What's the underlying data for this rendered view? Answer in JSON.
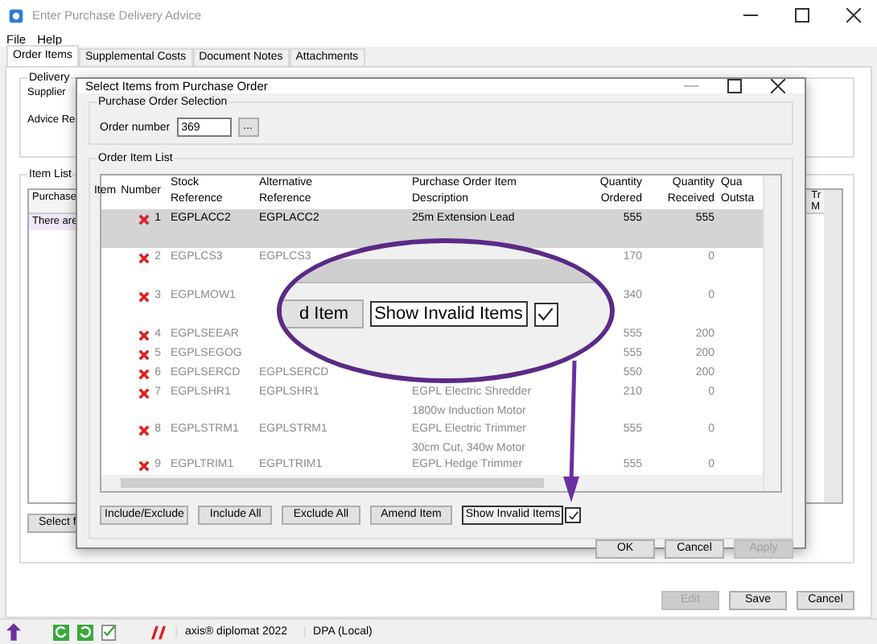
{
  "window": {
    "title": "Enter Purchase Delivery Advice"
  },
  "menu": [
    "File",
    "Help"
  ],
  "tabs": [
    {
      "label": "Order Items",
      "selected": true
    },
    {
      "label": "Supplemental Costs",
      "selected": false
    },
    {
      "label": "Document Notes",
      "selected": false
    },
    {
      "label": "Attachments",
      "selected": false
    }
  ],
  "delivery": {
    "title": "Delivery",
    "labels": [
      "Supplier",
      "Advice Re"
    ]
  },
  "item_list": {
    "title": "Item List",
    "column_1": "Purchase",
    "row_text": "There are",
    "column_last": [
      "Tr",
      "M"
    ],
    "select_button": "Select f"
  },
  "bottom_buttons": [
    {
      "label": "Edit",
      "disabled": true
    },
    {
      "label": "Save",
      "disabled": false
    },
    {
      "label": "Cancel",
      "disabled": false
    }
  ],
  "status_bar": {
    "product": "axis® diplomat 2022",
    "database": "DPA (Local)"
  },
  "dialog": {
    "title": "Select Items from Purchase Order",
    "selection": {
      "title": "Purchase Order Selection",
      "label": "Order number",
      "value": "369",
      "browse": "..."
    },
    "list_title": "Order Item List",
    "columns": [
      [
        "Item",
        "Number"
      ],
      [
        "Stock",
        "Reference"
      ],
      [
        "Alternative",
        "Reference"
      ],
      [
        "Purchase Order Item",
        "Description"
      ],
      [
        "Quantity",
        "Ordered"
      ],
      [
        "Quantity",
        "Received"
      ],
      [
        "Qua",
        "Outsta"
      ]
    ],
    "rows": [
      {
        "number": "1",
        "stock": "EGPLACC2",
        "alt": "EGPLACC2",
        "description": [
          "25m Extension Lead"
        ],
        "ordered": "555",
        "received": "555",
        "excluded": true,
        "selected": true,
        "disabled": false
      },
      {
        "number": "2",
        "stock": "EGPLCS3",
        "alt": "EGPLCS3",
        "description": [],
        "ordered": "170",
        "received": "0",
        "excluded": true,
        "selected": false,
        "disabled": true
      },
      {
        "number": "3",
        "stock": "EGPLMOW1",
        "alt": "",
        "description": [],
        "ordered": "340",
        "received": "0",
        "excluded": true,
        "selected": false,
        "disabled": true
      },
      {
        "number": "4",
        "stock": "EGPLSEEAR",
        "alt": "",
        "description": [],
        "ordered": "555",
        "received": "200",
        "excluded": true,
        "selected": false,
        "disabled": true
      },
      {
        "number": "5",
        "stock": "EGPLSEGOG",
        "alt": "",
        "description": [],
        "ordered": "555",
        "received": "200",
        "excluded": true,
        "selected": false,
        "disabled": true
      },
      {
        "number": "6",
        "stock": "EGPLSERCD",
        "alt": "EGPLSERCD",
        "description": [],
        "ordered": "550",
        "received": "200",
        "excluded": true,
        "selected": false,
        "disabled": true
      },
      {
        "number": "7",
        "stock": "EGPLSHR1",
        "alt": "EGPLSHR1",
        "description": [
          "EGPL Electric Shredder",
          "1800w Induction Motor"
        ],
        "ordered": "210",
        "received": "0",
        "excluded": true,
        "selected": false,
        "disabled": true
      },
      {
        "number": "8",
        "stock": "EGPLSTRM1",
        "alt": "EGPLSTRM1",
        "description": [
          "EGPL Electric Trimmer",
          "30cm Cut, 340w Motor"
        ],
        "ordered": "555",
        "received": "0",
        "excluded": true,
        "selected": false,
        "disabled": true
      },
      {
        "number": "9",
        "stock": "EGPLTRIM1",
        "alt": "EGPLTRIM1",
        "description": [
          "EGPL Hedge Trimmer"
        ],
        "ordered": "555",
        "received": "0",
        "excluded": true,
        "selected": false,
        "disabled": true
      }
    ],
    "list_buttons": [
      "Include/Exclude",
      "Include All",
      "Exclude All",
      "Amend Item"
    ],
    "show_invalid": {
      "label": "Show Invalid Items",
      "checked": true
    },
    "footer_buttons": [
      {
        "label": "OK",
        "disabled": false
      },
      {
        "label": "Cancel",
        "disabled": false
      },
      {
        "label": "Apply",
        "disabled": true
      }
    ]
  },
  "callout": {
    "button": "d Item",
    "label": "Show Invalid Items",
    "checked": true
  }
}
